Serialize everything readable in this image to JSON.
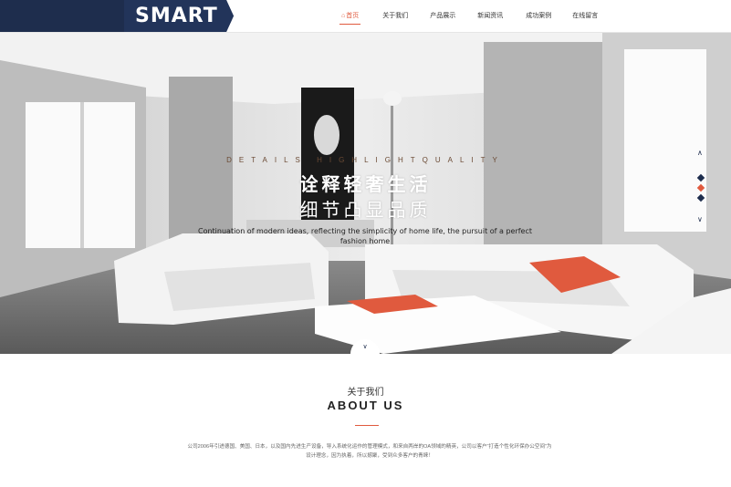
{
  "header": {
    "logo": "SMART",
    "nav": [
      {
        "label": "首页",
        "active": true,
        "icon": "home-icon"
      },
      {
        "label": "关于我们",
        "active": false
      },
      {
        "label": "产品展示",
        "active": false
      },
      {
        "label": "新闻资讯",
        "active": false
      },
      {
        "label": "成功案例",
        "active": false
      },
      {
        "label": "在线留言",
        "active": false
      }
    ]
  },
  "hero": {
    "tagline_en": "DETAILS HIGHLIGHTQUALITY",
    "title_line1": "诠释轻奢生活",
    "title_line2": "细节凸显品质",
    "description_en": "Continuation of modern ideas, reflecting the simplicity of home life, the pursuit of a perfect fashion home",
    "slider_up_icon": "chevron-up-icon",
    "slider_down_icon": "chevron-down-icon",
    "slides": [
      {
        "color": "#1e2d4d",
        "active": false
      },
      {
        "color": "#e05a3e",
        "active": true
      },
      {
        "color": "#1e2d4d",
        "active": false
      }
    ]
  },
  "about": {
    "title_cn": "关于我们",
    "title_en": "ABOUT US",
    "text": "公司2006年引进德国、美国、日本，以及国内先进生产设备，导入系统化运作的管理模式，和来自两岸的OA领域的精英，公司以客户“打造个性化环保办公空间”为设计理念，因为执着，所以撼聚，受到众多客户的青睐！"
  },
  "colors": {
    "brand_navy": "#1e2d4d",
    "accent": "#e05a3e"
  }
}
